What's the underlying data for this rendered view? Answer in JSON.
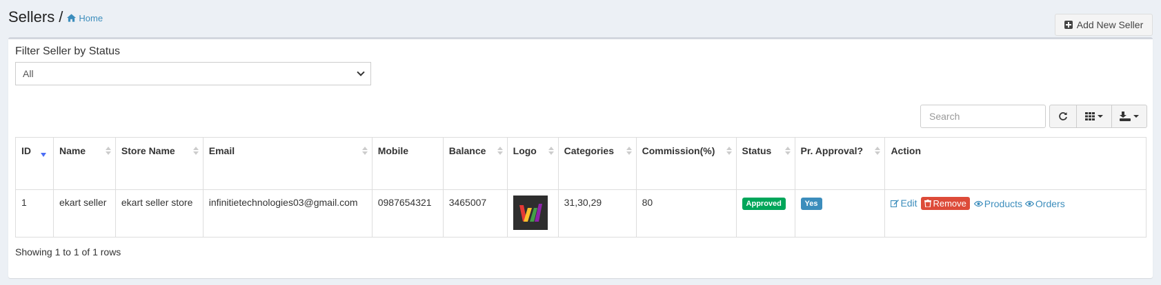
{
  "header": {
    "title": "Sellers",
    "separator": "/",
    "breadcrumb_home": "Home",
    "add_button": "Add New Seller"
  },
  "filter": {
    "label": "Filter Seller by Status",
    "selected": "All"
  },
  "toolbar": {
    "search_placeholder": "Search",
    "buttons": [
      "refresh-icon",
      "columns-icon",
      "export-icon"
    ]
  },
  "table": {
    "columns": [
      "ID",
      "Name",
      "Store Name",
      "Email",
      "Mobile",
      "Balance",
      "Logo",
      "Categories",
      "Commission(%)",
      "Status",
      "Pr. Approval?",
      "Action"
    ],
    "rows": [
      {
        "id": "1",
        "name": "ekart seller",
        "store_name": "ekart seller store",
        "email": "infinitietechnologies03@gmail.com",
        "mobile": "0987654321",
        "balance": "3465007",
        "categories": "31,30,29",
        "commission": "80",
        "status": "Approved",
        "pr_approval": "Yes",
        "actions": {
          "edit": "Edit",
          "remove": "Remove",
          "products": "Products",
          "orders": "Orders"
        }
      }
    ]
  },
  "pagination": {
    "info": "Showing 1 to 1 of 1 rows"
  },
  "colors": {
    "accent": "#3c8dbc",
    "success": "#00a65a",
    "danger": "#dd4b39",
    "background": "#ecf0f5"
  }
}
